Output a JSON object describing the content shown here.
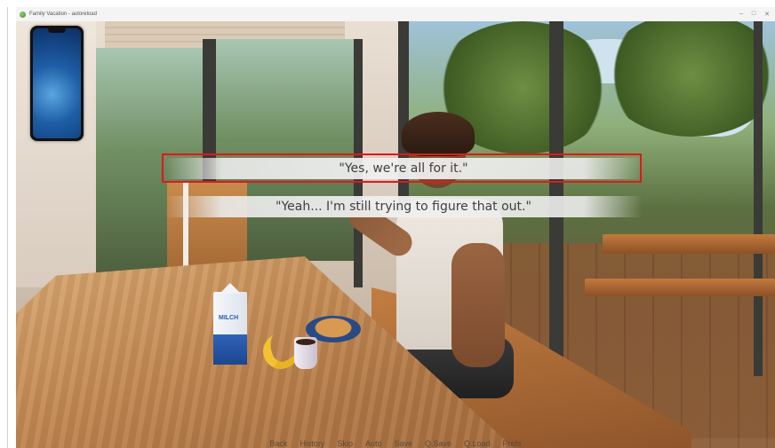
{
  "window": {
    "title": "Family Vacation - autoreload",
    "controls": [
      "–",
      "□",
      "✕"
    ]
  },
  "dialogue": {
    "choices": [
      "\"Yes, we're all for it.\"",
      "\"Yeah... I'm still trying to figure that out.\""
    ]
  },
  "milk_label": "MILCH",
  "quick_menu": [
    "Back",
    "History",
    "Skip",
    "Auto",
    "Save",
    "Q.Save",
    "Q.Load",
    "Prefs"
  ],
  "colors": {
    "highlight": "#e0191c"
  },
  "icons": {
    "app": "app-icon",
    "phone": "phone-icon"
  }
}
